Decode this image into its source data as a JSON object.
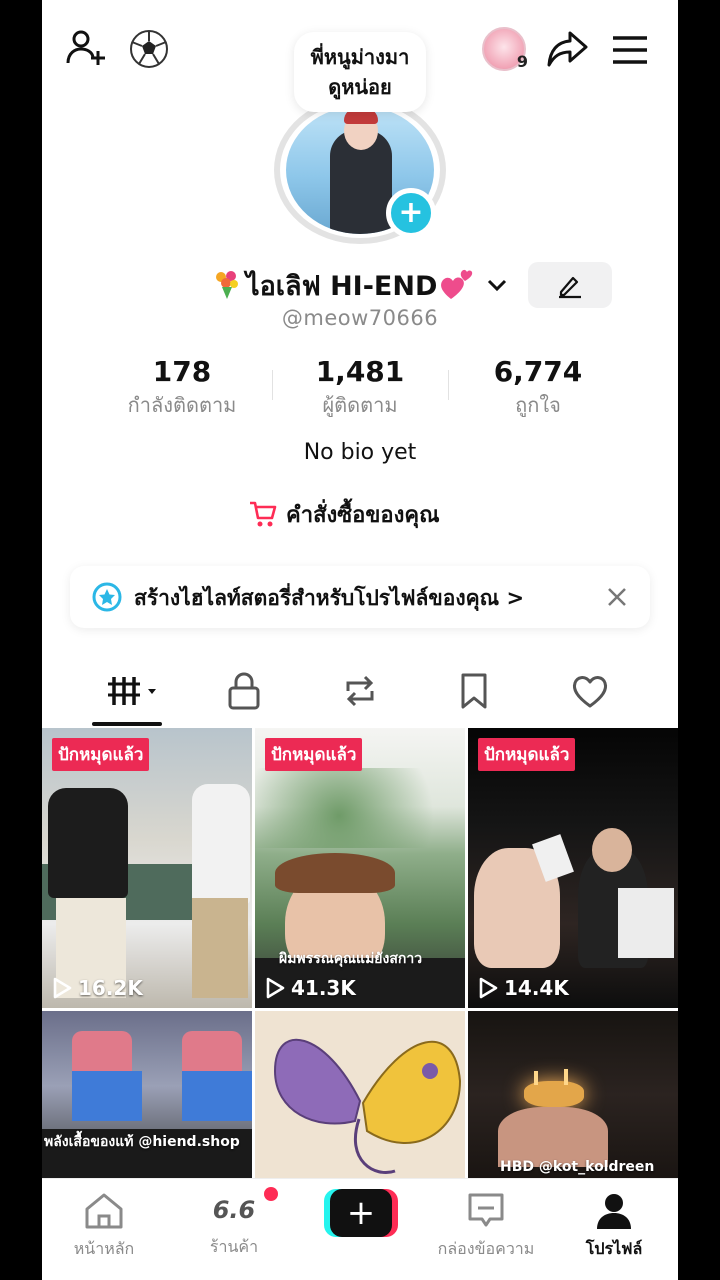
{
  "header": {
    "add_friend_icon": "add-friend-icon",
    "football_icon": "soccer-ball-icon",
    "stories_count": "9",
    "share_icon": "share-arrow-icon",
    "menu_icon": "hamburger-menu-icon"
  },
  "profile": {
    "note_line1": "พี่หนูม่างมา",
    "note_line2": "ดูหน่อย",
    "display_name": "ไอเลิฟ HI-END",
    "username": "@meow70666",
    "bio": "No bio yet",
    "orders_label": "คำสั่งซื้อของคุณ"
  },
  "stats": [
    {
      "value": "178",
      "label": "กำลังติดตาม"
    },
    {
      "value": "1,481",
      "label": "ผู้ติดตาม"
    },
    {
      "value": "6,774",
      "label": "ถูกใจ"
    }
  ],
  "banner": {
    "text": "สร้างไฮไลท์สตอรี่สำหรับโปรไฟล์ของคุณ",
    "chevron": ">"
  },
  "tabs": [
    {
      "icon": "videos-grid-icon",
      "active": true
    },
    {
      "icon": "lock-icon"
    },
    {
      "icon": "repost-icon"
    },
    {
      "icon": "bookmark-icon"
    },
    {
      "icon": "heart-icon"
    }
  ],
  "videos": [
    {
      "badge": "ปักหมุดแล้ว",
      "views": "16.2K"
    },
    {
      "badge": "ปักหมุดแล้ว",
      "views": "41.3K",
      "caption": "ผิมพรรณคุณแม่ยังสกาว"
    },
    {
      "badge": "ปักหมุดแล้ว",
      "views": "14.4K"
    },
    {
      "caption": "พลังเสื้อของแท้ @hiend.shop"
    },
    {},
    {
      "caption": "HBD @kot_koldreen"
    }
  ],
  "bottom_nav": {
    "home": "หน้าหลัก",
    "shop_badge": "6.6",
    "shop": "ร้านค้า",
    "create": "+",
    "inbox": "กล่องข้อความ",
    "profile": "โปรไฟล์"
  },
  "colors": {
    "accent_pink": "#fe2c55",
    "accent_cyan": "#25f4ee",
    "plus_badge": "#25c2e0",
    "pinned_badge": "#ec2a54"
  }
}
